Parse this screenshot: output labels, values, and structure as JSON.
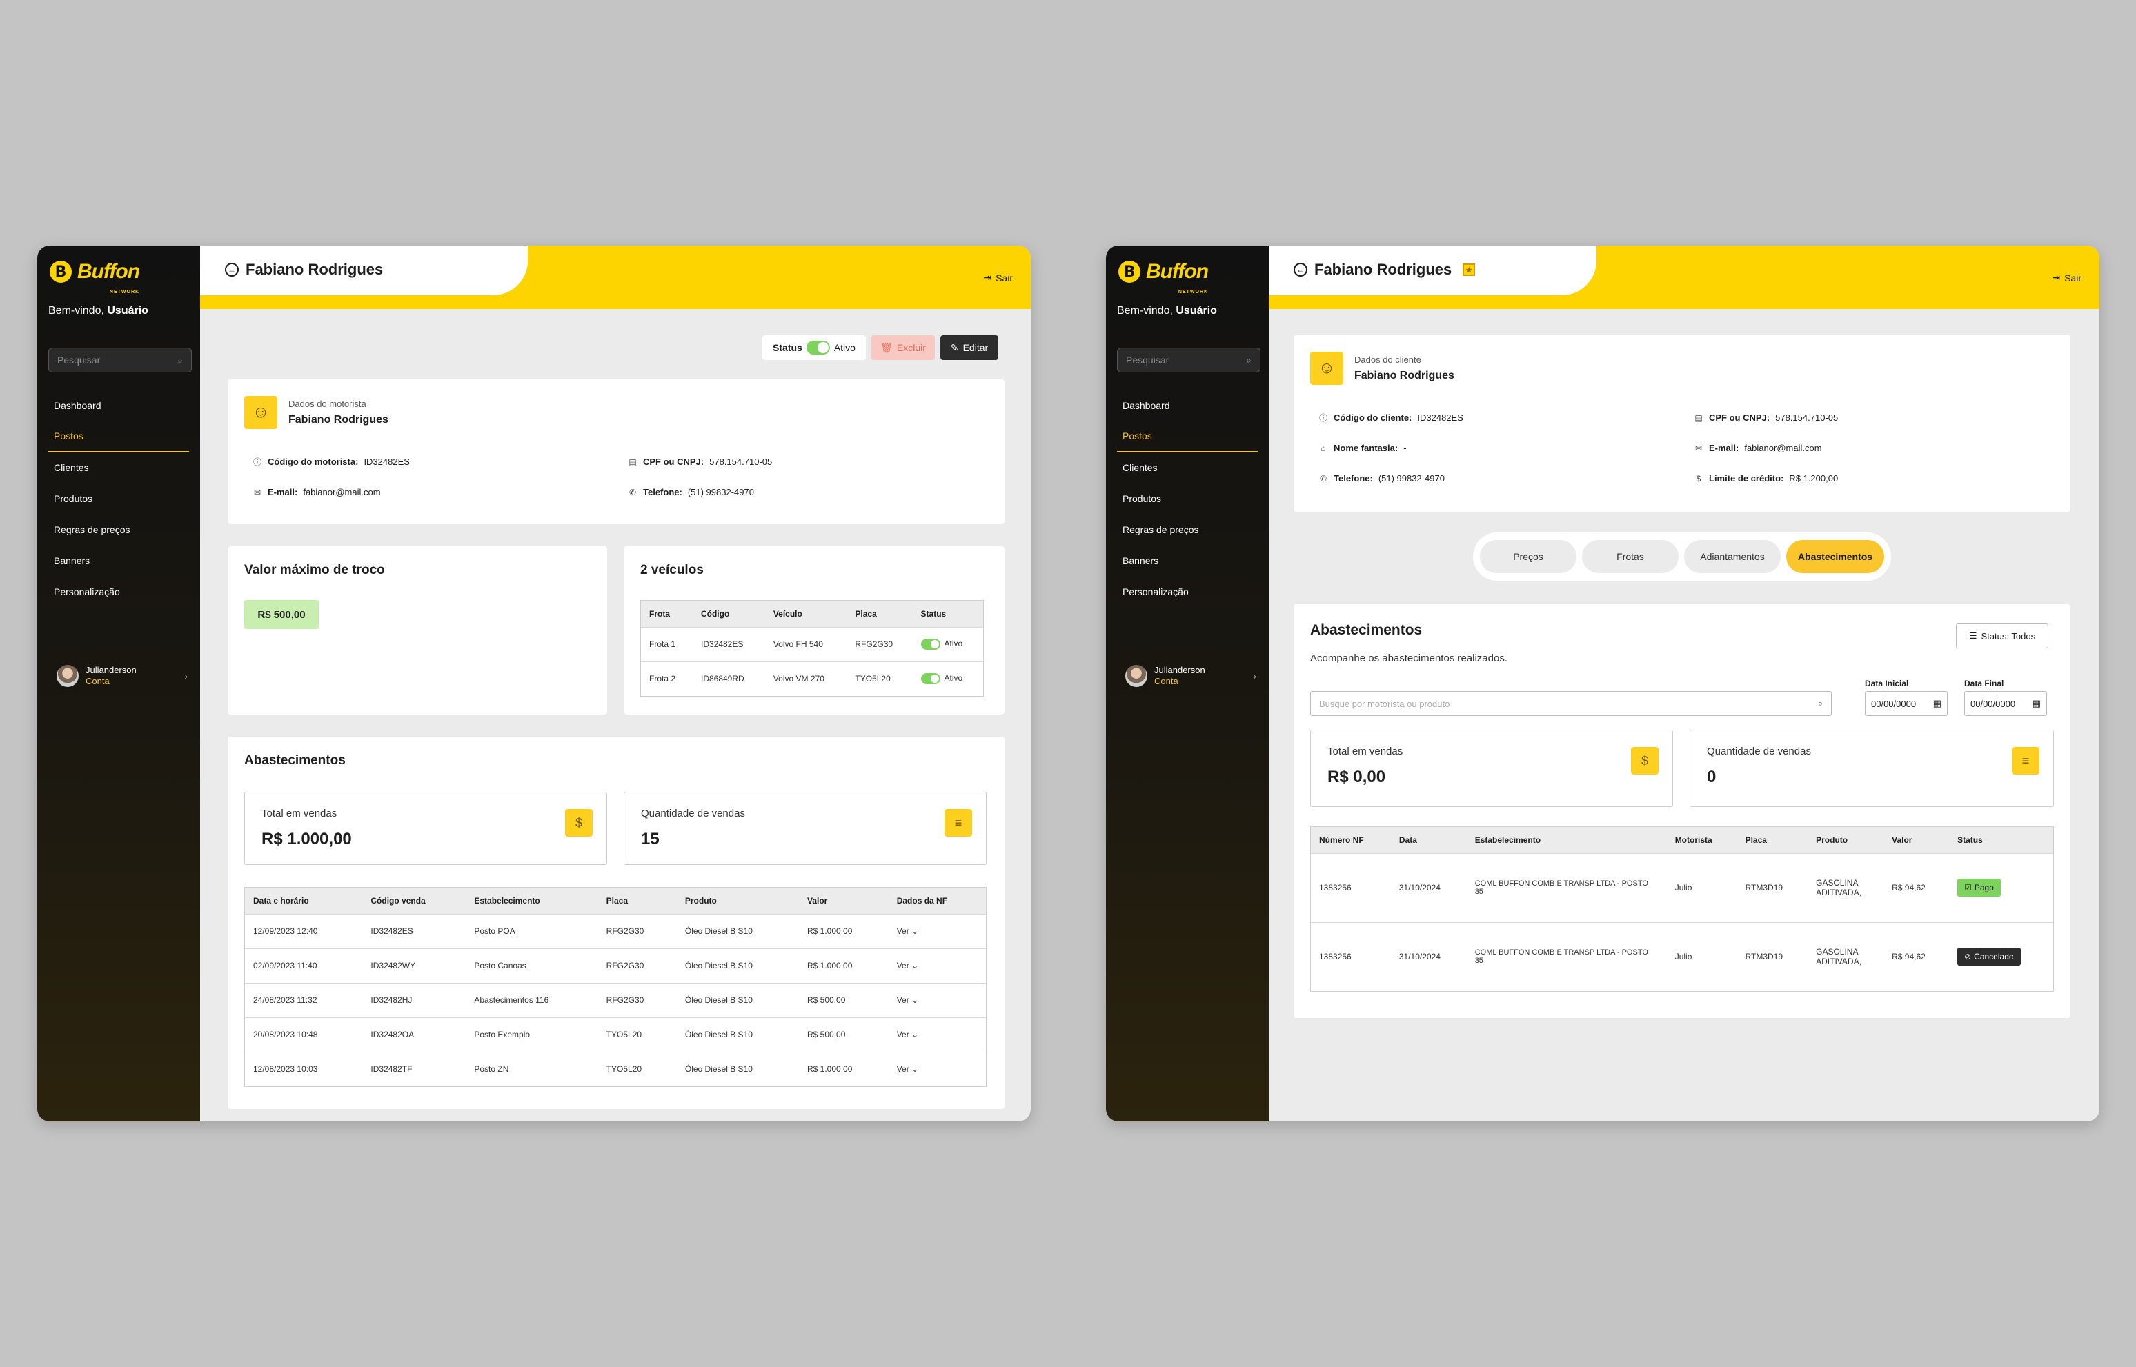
{
  "sidebar": {
    "logo_text": "Buffon",
    "logo_sub": "NETWORK",
    "welcome_prefix": "Bem-vindo,",
    "welcome_user": "Usuário",
    "search_placeholder": "Pesquisar",
    "items": [
      "Dashboard",
      "Postos",
      "Clientes",
      "Produtos",
      "Regras de preços",
      "Banners",
      "Personalização"
    ],
    "user_name": "Julianderson",
    "user_link": "Conta"
  },
  "left": {
    "title": "Fabiano Rodrigues",
    "exit": "Sair",
    "status_label": "Status",
    "status_value": "Ativo",
    "delete": "Excluir",
    "edit": "Editar",
    "data_title": "Dados do motorista",
    "name": "Fabiano Rodrigues",
    "code_label": "Código do motorista:",
    "code_value": "ID32482ES",
    "cpf_label": "CPF ou CNPJ:",
    "cpf_value": "578.154.710-05",
    "email_label": "E-mail:",
    "email_value": "fabianor@mail.com",
    "phone_label": "Telefone:",
    "phone_value": "(51) 99832-4970",
    "troco_title": "Valor máximo de troco",
    "troco_value": "R$ 500,00",
    "vehicles_title": "2 veículos",
    "vehicles_headers": [
      "Frota",
      "Código",
      "Veículo",
      "Placa",
      "Status"
    ],
    "vehicles_rows": [
      [
        "Frota 1",
        "ID32482ES",
        "Volvo FH 540",
        "RFG2G30",
        "Ativo"
      ],
      [
        "Frota 2",
        "ID86849RD",
        "Volvo VM 270",
        "TYO5L20",
        "Ativo"
      ]
    ],
    "abast_title": "Abastecimentos",
    "total_label": "Total em vendas",
    "total_value": "R$ 1.000,00",
    "qty_label": "Quantidade de vendas",
    "qty_value": "15",
    "abast_headers": [
      "Data e horário",
      "Código venda",
      "Estabelecimento",
      "Placa",
      "Produto",
      "Valor",
      "Dados da NF"
    ],
    "abast_rows": [
      [
        "12/09/2023 12:40",
        "ID32482ES",
        "Posto POA",
        "RFG2G30",
        "Óleo Diesel B S10",
        "R$ 1.000,00",
        "Ver"
      ],
      [
        "02/09/2023 11:40",
        "ID32482WY",
        "Posto Canoas",
        "RFG2G30",
        "Óleo Diesel B S10",
        "R$ 1.000,00",
        "Ver"
      ],
      [
        "24/08/2023 11:32",
        "ID32482HJ",
        "Abastecimentos 116",
        "RFG2G30",
        "Óleo Diesel B S10",
        "R$ 500,00",
        "Ver"
      ],
      [
        "20/08/2023 10:48",
        "ID32482OA",
        "Posto Exemplo",
        "TYO5L20",
        "Óleo Diesel B S10",
        "R$ 500,00",
        "Ver"
      ],
      [
        "12/08/2023 10:03",
        "ID32482TF",
        "Posto ZN",
        "TYO5L20",
        "Óleo Diesel B S10",
        "R$ 1.000,00",
        "Ver"
      ]
    ]
  },
  "right": {
    "title": "Fabiano Rodrigues",
    "exit": "Sair",
    "data_title": "Dados do cliente",
    "name": "Fabiano Rodrigues",
    "code_label": "Código do cliente:",
    "code_value": "ID32482ES",
    "cpf_label": "CPF ou CNPJ:",
    "cpf_value": "578.154.710-05",
    "fantasia_label": "Nome fantasia:",
    "fantasia_value": "-",
    "email_label": "E-mail:",
    "email_value": "fabianor@mail.com",
    "phone_label": "Telefone:",
    "phone_value": "(51) 99832-4970",
    "credit_label": "Limite de crédito:",
    "credit_value": "R$ 1.200,00",
    "tabs": [
      "Preços",
      "Frotas",
      "Adiantamentos",
      "Abastecimentos"
    ],
    "abast_title": "Abastecimentos",
    "abast_sub": "Acompanhe os abastecimentos realizados.",
    "status_filter": "Status: Todos",
    "search_placeholder": "Busque por motorista ou produto",
    "date_start_label": "Data Inicial",
    "date_end_label": "Data Final",
    "date_value": "00/00/0000",
    "total_label": "Total em vendas",
    "total_value": "R$ 0,00",
    "qty_label": "Quantidade de vendas",
    "qty_value": "0",
    "headers": [
      "Número NF",
      "Data",
      "Estabelecimento",
      "Motorista",
      "Placa",
      "Produto",
      "Valor",
      "Status"
    ],
    "rows": [
      [
        "1383256",
        "31/10/2024",
        "COML BUFFON COMB E TRANSP LTDA - POSTO 35",
        "Julio",
        "RTM3D19",
        "GASOLINA ADITIVADA,",
        "R$ 94,62",
        "Pago"
      ],
      [
        "1383256",
        "31/10/2024",
        "COML BUFFON COMB E TRANSP LTDA - POSTO 35",
        "Julio",
        "RTM3D19",
        "GASOLINA ADITIVADA,",
        "R$ 94,62",
        "Cancelado"
      ]
    ]
  },
  "colors": {
    "brand_yellow": "#fdd400",
    "accent": "#f4c430",
    "paid": "#7ed35f",
    "cancel": "#2d2d2d"
  }
}
